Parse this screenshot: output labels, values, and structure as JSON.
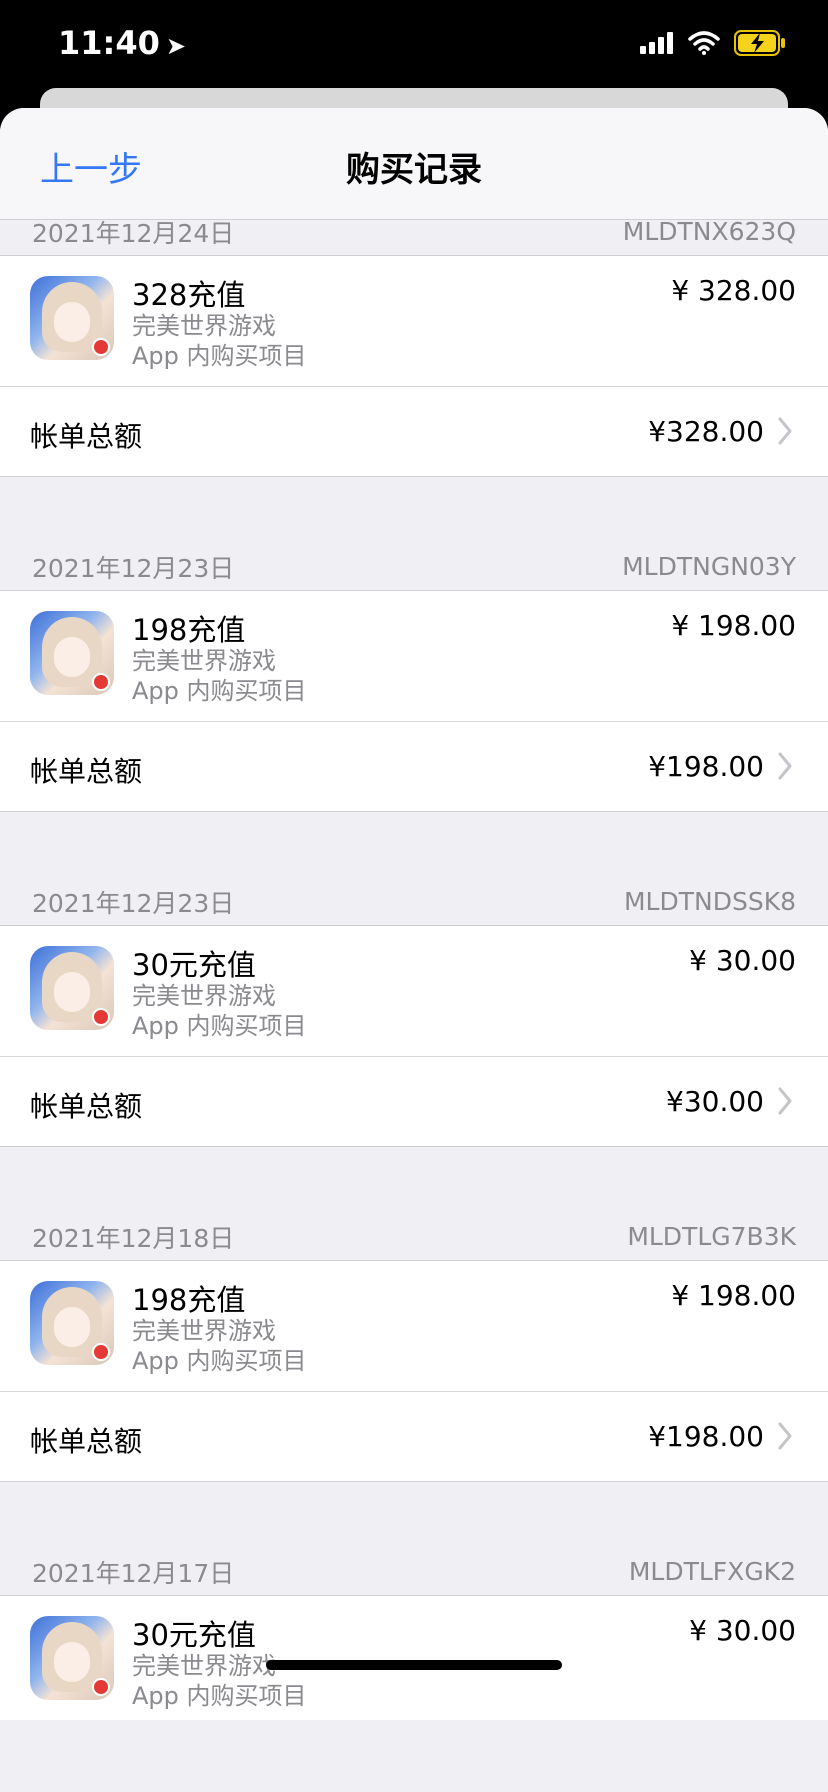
{
  "status": {
    "time": "11:40"
  },
  "nav": {
    "back_label": "上一步",
    "title": "购买记录"
  },
  "total_label": "帐单总额",
  "sections": [
    {
      "date": "2021年12月24日",
      "order_id": "MLDTNX623Q",
      "item_name": "328充值",
      "app_name": "完美世界游戏",
      "item_type": "App 内购买项目",
      "price": "¥ 328.00",
      "total": "¥328.00"
    },
    {
      "date": "2021年12月23日",
      "order_id": "MLDTNGN03Y",
      "item_name": "198充值",
      "app_name": "完美世界游戏",
      "item_type": "App 内购买项目",
      "price": "¥ 198.00",
      "total": "¥198.00"
    },
    {
      "date": "2021年12月23日",
      "order_id": "MLDTNDSSK8",
      "item_name": "30元充值",
      "app_name": "完美世界游戏",
      "item_type": "App 内购买项目",
      "price": "¥ 30.00",
      "total": "¥30.00"
    },
    {
      "date": "2021年12月18日",
      "order_id": "MLDTLG7B3K",
      "item_name": "198充值",
      "app_name": "完美世界游戏",
      "item_type": "App 内购买项目",
      "price": "¥ 198.00",
      "total": "¥198.00"
    },
    {
      "date": "2021年12月17日",
      "order_id": "MLDTLFXGK2",
      "item_name": "30元充值",
      "app_name": "完美世界游戏",
      "item_type": "App 内购买项目",
      "price": "¥ 30.00",
      "total": ""
    }
  ],
  "colors": {
    "accent": "#3478f6",
    "secondary_text": "#8a8a8f",
    "background": "#f0f0f4"
  }
}
